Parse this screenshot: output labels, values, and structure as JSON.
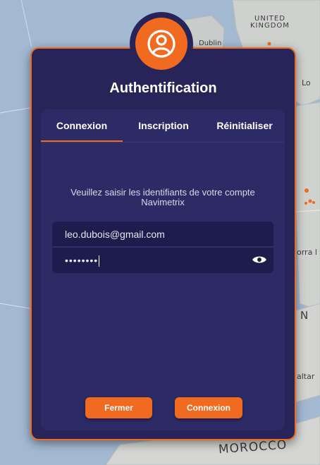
{
  "map": {
    "labels": {
      "uk_line1": "UNITED",
      "uk_line2": "KINGDOM",
      "dublin": "Dublin",
      "morocco": "MOROCCO",
      "london_partial": "Lo",
      "andorra_partial": "orra l",
      "spain_partial": "N",
      "gibraltar_partial": "altar"
    }
  },
  "dialog": {
    "title": "Authentification",
    "icon": "user-circle-icon",
    "accent_color": "#f06b1f",
    "background_color": "#27245a"
  },
  "tabs": [
    {
      "label": "Connexion",
      "active": true
    },
    {
      "label": "Inscription",
      "active": false
    },
    {
      "label": "Réinitialiser",
      "active": false
    }
  ],
  "form": {
    "instruction": "Veuillez saisir les identifiants de votre compte Navimetrix",
    "email_value": "leo.dubois@gmail.com",
    "password_masked": "••••••••"
  },
  "buttons": {
    "close_label": "Fermer",
    "login_label": "Connexion"
  }
}
